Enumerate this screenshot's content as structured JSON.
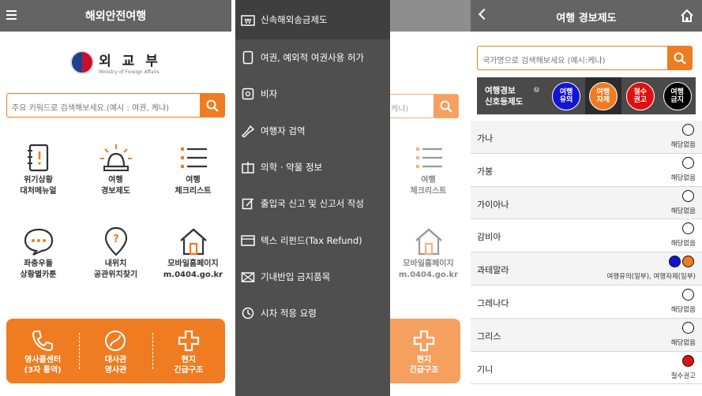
{
  "screen1": {
    "title": "해외안전여행",
    "logo_text": "외 교 부",
    "logo_sub": "Ministry of Foreign Affairs",
    "search_placeholder": "주요 키워드로 검색해보세요.(예시 : 여권, 케냐)",
    "tiles": [
      {
        "line1": "위기상황",
        "line2": "대처메뉴얼",
        "icon": "manual-icon"
      },
      {
        "line1": "여행",
        "line2": "경보제도",
        "icon": "alarm-light-icon"
      },
      {
        "line1": "여행",
        "line2": "체크리스트",
        "icon": "checklist-icon"
      },
      {
        "line1": "좌충우돌",
        "line2": "상황별카툰",
        "icon": "speech-bubble-icon"
      },
      {
        "line1": "내위치",
        "line2": "공관위치찾기",
        "icon": "location-pin-icon"
      },
      {
        "line1": "모바일홈페이지",
        "line2": "m.0404.go.kr",
        "icon": "house-icon"
      }
    ],
    "bottom_buttons": [
      {
        "line1": "영사콜센터",
        "line2": "(3자 통역)",
        "icon": "phone-icon"
      },
      {
        "line1": "대사관",
        "line2": "영사관",
        "icon": "embassy-icon"
      },
      {
        "line1": "현지",
        "line2": "긴급구조",
        "icon": "medical-cross-icon"
      }
    ]
  },
  "screen2": {
    "bg_search_placeholder": "케냐)",
    "bg_tile": {
      "line1": "여행",
      "line2": "체크리스트"
    },
    "bg_tile2": {
      "line1": "모바일홈페이지",
      "line2": "m.0404.go.kr"
    },
    "bg_button": {
      "line1": "현지",
      "line2": "긴급구조"
    },
    "menu": [
      {
        "label": "신속해외송금제도",
        "icon": "remittance-icon"
      },
      {
        "label": "여권, 예외적 여권사용 허가",
        "icon": "passport-icon"
      },
      {
        "label": "비자",
        "icon": "visa-icon"
      },
      {
        "label": "여행자 검역",
        "icon": "quarantine-icon"
      },
      {
        "label": "의학 · 약물 정보",
        "icon": "medicine-icon"
      },
      {
        "label": "출입국 신고 및 신고서 작성",
        "icon": "form-edit-icon"
      },
      {
        "label": "텍스 리펀드(Tax Refund)",
        "icon": "tax-refund-icon"
      },
      {
        "label": "기내반입 금지품목",
        "icon": "prohibited-items-icon"
      },
      {
        "label": "시차 적응 요령",
        "icon": "clock-icon"
      }
    ]
  },
  "screen3": {
    "title": "여행 경보제도",
    "search_placeholder": "국가명으로 검색해보세요 (예시:케냐)",
    "legend_title_1": "여행경보",
    "legend_title_2": "신호등제도",
    "legend": [
      {
        "line1": "여행",
        "line2": "유의",
        "color": "#1414d2"
      },
      {
        "line1": "여행",
        "line2": "자제",
        "color": "#f07c22"
      },
      {
        "line1": "철수",
        "line2": "권고",
        "color": "#e01010"
      },
      {
        "line1": "여행",
        "line2": "금지",
        "color": "#000000"
      }
    ],
    "countries": [
      {
        "name": "가나",
        "status": "해당없음",
        "dots": [
          "#ffffff"
        ]
      },
      {
        "name": "가봉",
        "status": "해당없음",
        "dots": [
          "#ffffff"
        ]
      },
      {
        "name": "가이아나",
        "status": "해당없음",
        "dots": [
          "#ffffff"
        ]
      },
      {
        "name": "감비아",
        "status": "해당없음",
        "dots": [
          "#ffffff"
        ]
      },
      {
        "name": "과테말라",
        "status": "여행유의(일부), 여행자제(일부)",
        "dots": [
          "#1414d2",
          "#f07c22"
        ]
      },
      {
        "name": "그레나다",
        "status": "해당없음",
        "dots": [
          "#ffffff"
        ]
      },
      {
        "name": "그리스",
        "status": "해당없음",
        "dots": [
          "#ffffff"
        ]
      },
      {
        "name": "기니",
        "status": "철수권고",
        "dots": [
          "#e01010"
        ]
      }
    ]
  }
}
